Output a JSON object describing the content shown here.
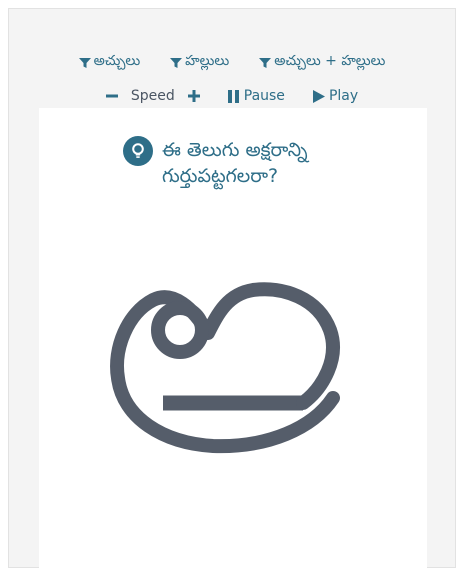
{
  "filters": {
    "vowels": "అచ్చులు",
    "consonants": "హల్లులు",
    "both": "అచ్చులు + హల్లులు"
  },
  "controls": {
    "speed": "Speed",
    "pause": "Pause",
    "play": "Play"
  },
  "quiz": {
    "question_line1": "ఈ తెలుగు అక్షరాన్ని",
    "question_line2": "గుర్తుపట్టగలరా?",
    "letter": "అ"
  },
  "colors": {
    "accent": "#2e6e88",
    "letter": "#555d6a",
    "panel": "#f4f4f4"
  },
  "icons": [
    "filter-icon",
    "minus-icon",
    "plus-icon",
    "pause-icon",
    "play-icon",
    "lightbulb-icon"
  ]
}
